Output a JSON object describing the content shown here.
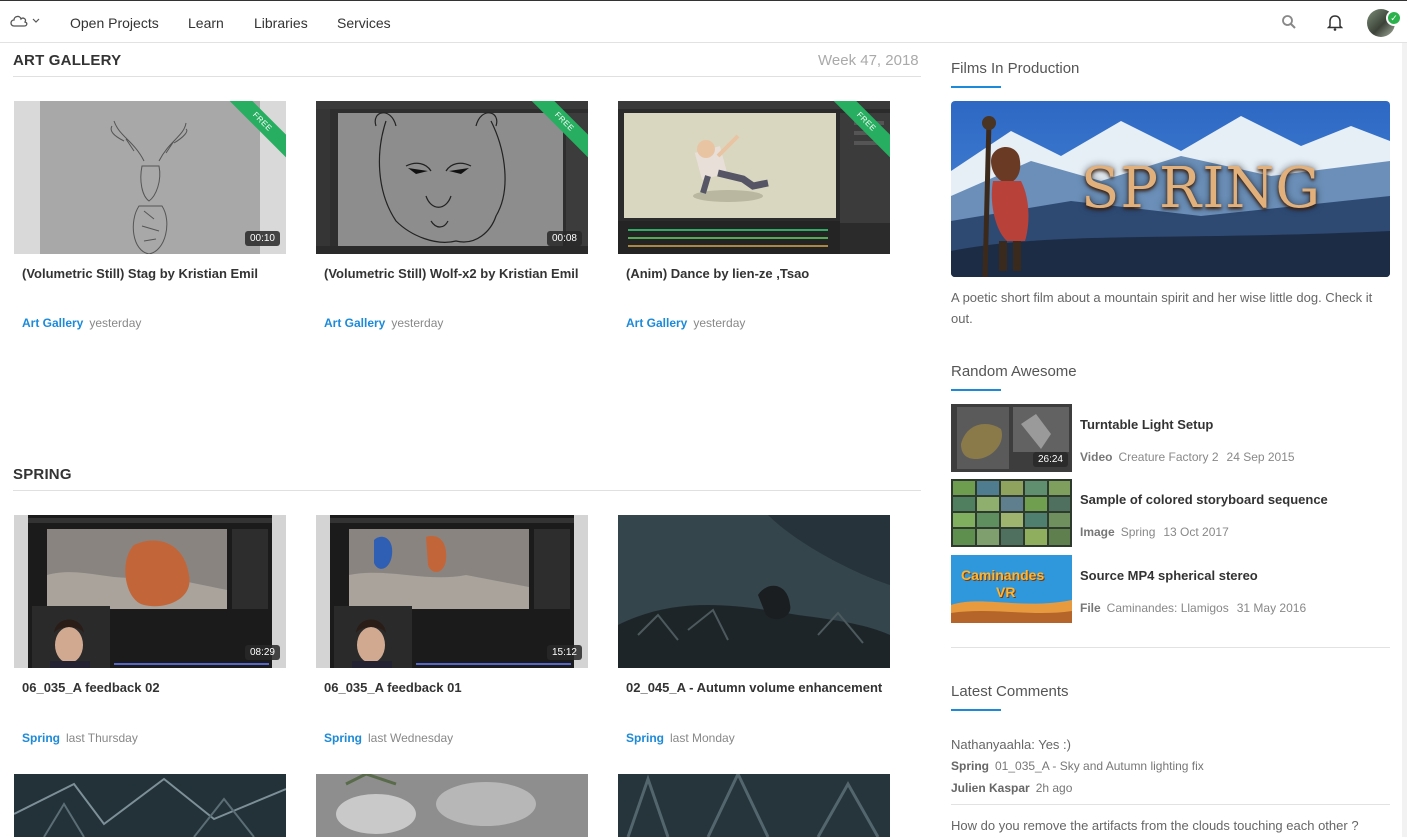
{
  "nav": {
    "links": [
      "Open Projects",
      "Learn",
      "Libraries",
      "Services"
    ]
  },
  "art_gallery": {
    "title": "ART GALLERY",
    "week": "Week 47, 2018",
    "cards": [
      {
        "title": "(Volumetric Still) Stag by Kristian Emil",
        "project": "Art Gallery",
        "when": "yesterday",
        "duration": "00:10",
        "badge": "FREE"
      },
      {
        "title": "(Volumetric Still) Wolf-x2 by Kristian Emil",
        "project": "Art Gallery",
        "when": "yesterday",
        "duration": "00:08",
        "badge": "FREE"
      },
      {
        "title": "(Anim) Dance by lien-ze ,Tsao",
        "project": "Art Gallery",
        "when": "yesterday",
        "badge": "FREE"
      }
    ]
  },
  "spring_section": {
    "title": "SPRING",
    "cards": [
      {
        "title": "06_035_A feedback 02",
        "project": "Spring",
        "when": "last Thursday",
        "duration": "08:29"
      },
      {
        "title": "06_035_A feedback 01",
        "project": "Spring",
        "when": "last Wednesday",
        "duration": "15:12"
      },
      {
        "title": "02_045_A - Autumn volume enhancement",
        "project": "Spring",
        "when": "last Monday"
      }
    ]
  },
  "sidebar": {
    "films_heading": "Films In Production",
    "film_banner_text": "SPRING",
    "film_description": "A poetic short film about a mountain spirit and her wise little dog. Check it out.",
    "random_heading": "Random Awesome",
    "random_items": [
      {
        "title": "Turntable Light Setup",
        "kind": "Video",
        "project": "Creature Factory 2",
        "date": "24 Sep 2015",
        "duration": "26:24"
      },
      {
        "title": "Sample of colored storyboard sequence",
        "kind": "Image",
        "project": "Spring",
        "date": "13 Oct 2017"
      },
      {
        "title": "Source MP4 spherical stereo",
        "kind": "File",
        "project": "Caminandes: Llamigos",
        "date": "31 May 2016",
        "thumb_text_1": "Caminandes",
        "thumb_text_2": "VR"
      }
    ],
    "comments_heading": "Latest Comments",
    "comments": [
      {
        "text": "Nathanyaahla: Yes :)",
        "project": "Spring",
        "context": "01_035_A - Sky and Autumn lighting fix",
        "author": "Julien Kaspar",
        "when": "2h ago"
      },
      {
        "text": "How do you remove the artifacts from the clouds touching each other ?"
      }
    ]
  },
  "colors": {
    "accent": "#1c8ad9",
    "free_ribbon": "#27ae60",
    "badge_check": "#2bb24c"
  }
}
